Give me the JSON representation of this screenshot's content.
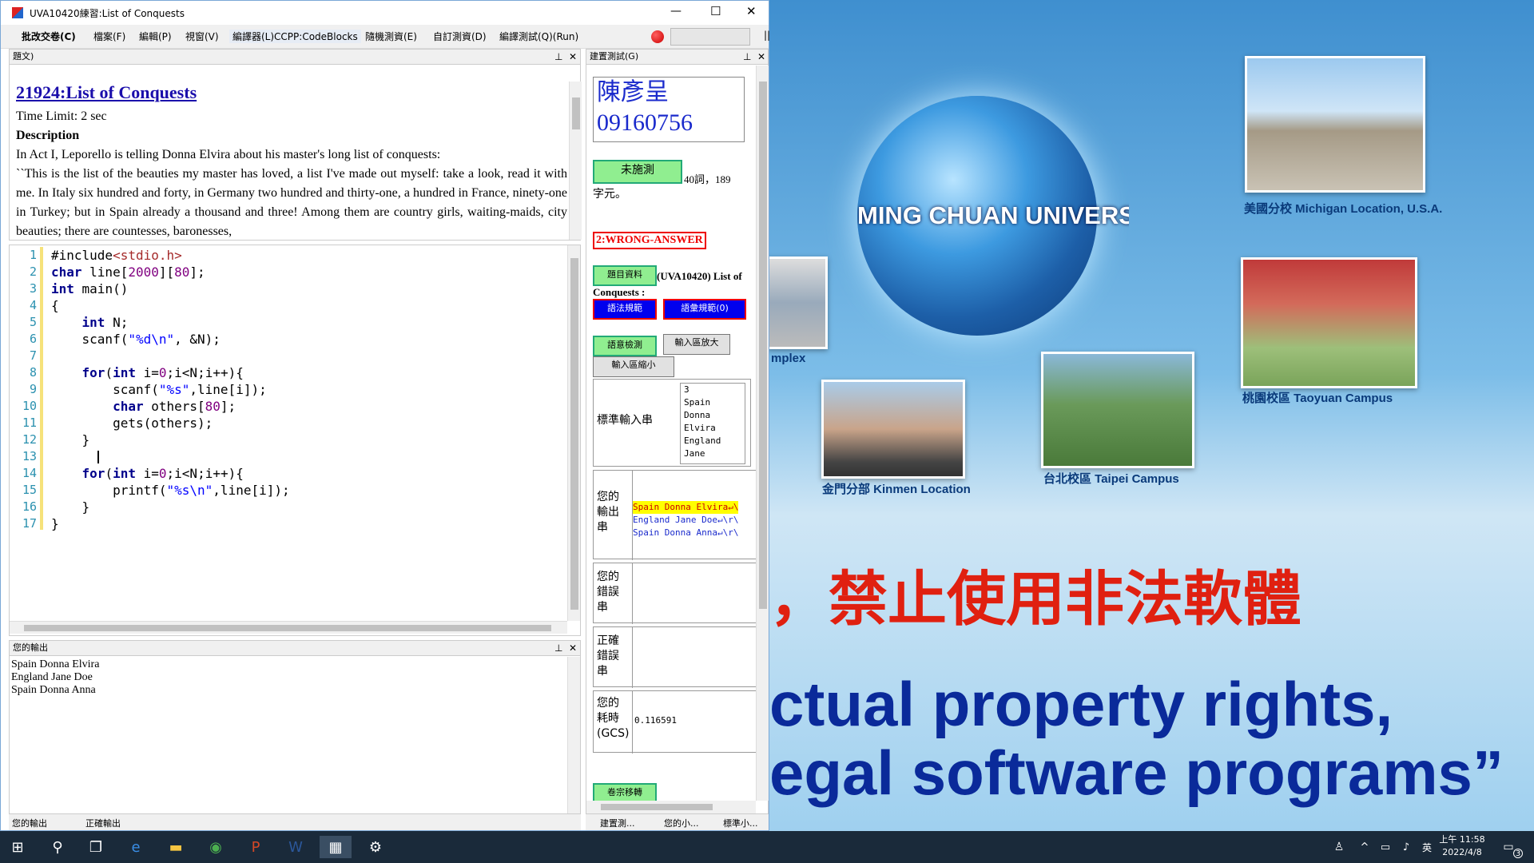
{
  "window": {
    "title": "UVA10420練習:List of Conquests",
    "controls": {
      "minimize": "—",
      "maximize": "☐",
      "close": "✕"
    }
  },
  "menubar": {
    "items": [
      "批改交卷(C)",
      "檔案(F)",
      "編輯(P)",
      "視窗(V)",
      "編譯器(L)CCPP:CodeBlocks",
      "隨機測資(E)",
      "自訂測資(D)",
      "編譯測試(Q)(Run)"
    ],
    "toolbar_end": "||"
  },
  "problem_pane": {
    "header": "題文)",
    "title": "21924:List of Conquests",
    "time_limit": "Time Limit: 2 sec",
    "description_heading": "Description",
    "para1": "In Act I, Leporello is telling Donna Elvira about his master's long list of conquests:",
    "para2": "``This is the list of the beauties my master has loved, a list I've made out myself: take a look, read it with me. In Italy six hundred and forty, in Germany two hundred and thirty-one, a hundred in France, ninety-one in Turkey; but in Spain already a thousand and three! Among them are country girls, waiting-maids, city beauties; there are countesses, baronesses,"
  },
  "editor": {
    "line_numbers": [
      "1",
      "2",
      "3",
      "4",
      "5",
      "6",
      "7",
      "8",
      "9",
      "10",
      "11",
      "12",
      "13",
      "14",
      "15",
      "16",
      "17"
    ],
    "lines": [
      "#include<stdio.h>",
      "char line[2000][80];",
      "int main()",
      "{",
      "    int N;",
      "    scanf(\"%d\\n\", &N);",
      "",
      "    for(int i=0;i<N;i++){",
      "        scanf(\"%s\",line[i]);",
      "        char others[80];",
      "        gets(others);",
      "    }",
      "    ",
      "    for(int i=0;i<N;i++){",
      "        printf(\"%s\\n\",line[i]);",
      "    }",
      "}"
    ]
  },
  "output_pane": {
    "header": "您的輸出",
    "lines": [
      "Spain Donna Elvira",
      "England Jane Doe",
      "Spain Donna Anna"
    ],
    "tabs": [
      "您的輸出",
      "正確輸出"
    ]
  },
  "test_pane": {
    "header": "建置測試(G)",
    "student_name": "陳彥呈",
    "student_id": "09160756",
    "status_button": "未施測",
    "word_count": "40詞，189",
    "char_count": "字元。",
    "verdict": "2:WRONG-ANSWER",
    "problem_info_button": "題目資料",
    "problem_ref": "(UVA10420) List of Conquests :",
    "syntax_button": "語法規範",
    "vocab_button": "語彙規範(0)",
    "semantic_button": "語意檢測",
    "enlarge_input_button": "輸入區放大",
    "shrink_input_button": "輸入區縮小",
    "rows": [
      {
        "label": "標準輸入串",
        "value_lines": [
          "3",
          "Spain",
          "Donna",
          "Elvira",
          "England",
          "Jane"
        ]
      },
      {
        "label": "您的輸出串",
        "value_lines": [
          "Spain Donna Elvira↵\\",
          "England Jane Doe↵\\r\\",
          "Spain Donna Anna↵\\r\\"
        ]
      },
      {
        "label": "您的錯誤串",
        "value_lines": []
      },
      {
        "label": "正確錯誤串",
        "value_lines": []
      },
      {
        "label": "您的耗時(GCS)",
        "value_lines": [
          "0.116591"
        ]
      }
    ],
    "transfer_button": "卷宗移轉",
    "tabs": [
      "建置測...",
      "您的小...",
      "標準小..."
    ]
  },
  "wallpaper": {
    "university": "MING CHUAN UNIVERSITY",
    "captions": [
      "美國分校 Michigan Location, U.S.A.",
      "桃園校區 Taoyuan Campus",
      "台北校區 Taipei Campus",
      "金門分部 Kinmen Location",
      "mplex"
    ],
    "slogan_cn": "，禁止使用非法軟體",
    "slogan_en1": "ctual property rights,",
    "slogan_en2": "egal software programs”"
  },
  "taskbar": {
    "time": "上午 11:58",
    "date": "2022/4/8",
    "notification_count": "3"
  },
  "colors": {
    "accent": "#1a5fb4",
    "error_red": "#e00000",
    "green": "#90ee90"
  }
}
